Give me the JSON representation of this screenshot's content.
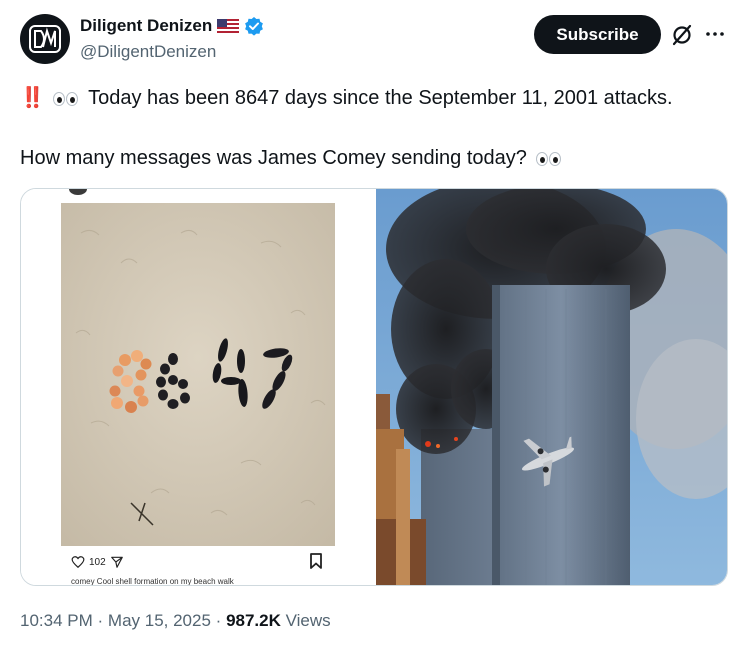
{
  "author": {
    "display_name": "Diligent Denizen",
    "handle": "@DiligentDenizen",
    "flag_emoji": "us-flag-icon",
    "verified": true,
    "verified_color": "#1d9bf0"
  },
  "actions": {
    "subscribe_label": "Subscribe",
    "grok_icon": "grok-icon",
    "more_icon": "more-icon"
  },
  "tweet": {
    "line1_prefix": "‼️",
    "line1_text": "Today has been 8647 days since the September 11, 2001 attacks.",
    "line2_text": "How many messages was James Comey sending today?",
    "emoji_eyes": "eyes-emoji"
  },
  "media": {
    "left_image": {
      "sand_text": "8647",
      "like_count": "102",
      "caption": "comey Cool shell formation on my beach walk"
    },
    "right_image": {
      "description_icon": "photo"
    }
  },
  "footer": {
    "time": "10:34 PM",
    "separator": "·",
    "date": "May 15, 2025",
    "views_count": "987.2K",
    "views_label": "Views"
  },
  "colors": {
    "text_primary": "#0f1419",
    "text_secondary": "#536471",
    "border": "#cfd9de",
    "verified": "#1d9bf0"
  }
}
